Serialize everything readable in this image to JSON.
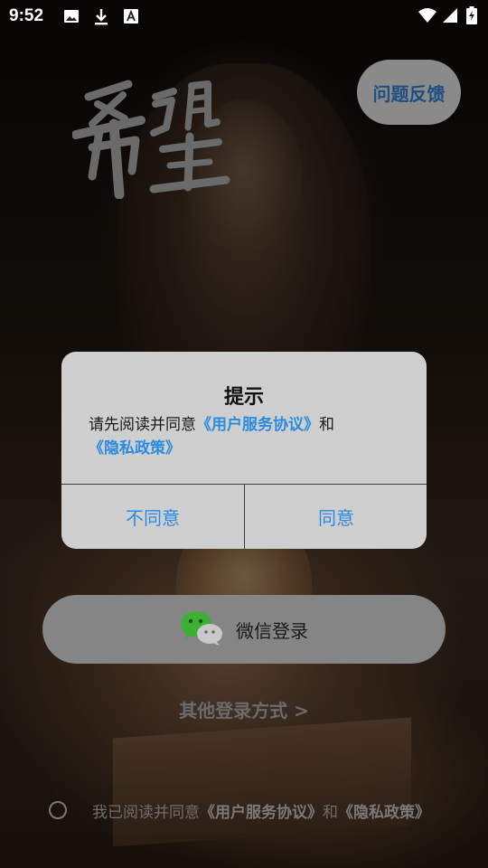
{
  "status_bar": {
    "time": "9:52",
    "icons": [
      "image-icon",
      "download-icon",
      "font-a-icon",
      "wifi-icon",
      "signal-icon",
      "battery-charging-icon"
    ]
  },
  "logo_alt": "希望",
  "feedback_button": "问题反馈",
  "dialog": {
    "title": "提示",
    "message_prefix": "请先阅读并同意",
    "user_agreement_link": "《用户服务协议》",
    "message_and": "和",
    "privacy_link": "《隐私政策》",
    "disagree": "不同意",
    "agree": "同意"
  },
  "wechat_login": "微信登录",
  "other_login": "其他登录方式 >",
  "agreement": {
    "prefix": "我已阅读并同意",
    "user_agreement_link": "《用户服务协议》",
    "and": "和",
    "privacy_link": "《隐私政策》"
  },
  "colors": {
    "link": "#2b8be0",
    "feedback_text": "#1e4f82",
    "wechat_green": "#3cb034"
  }
}
